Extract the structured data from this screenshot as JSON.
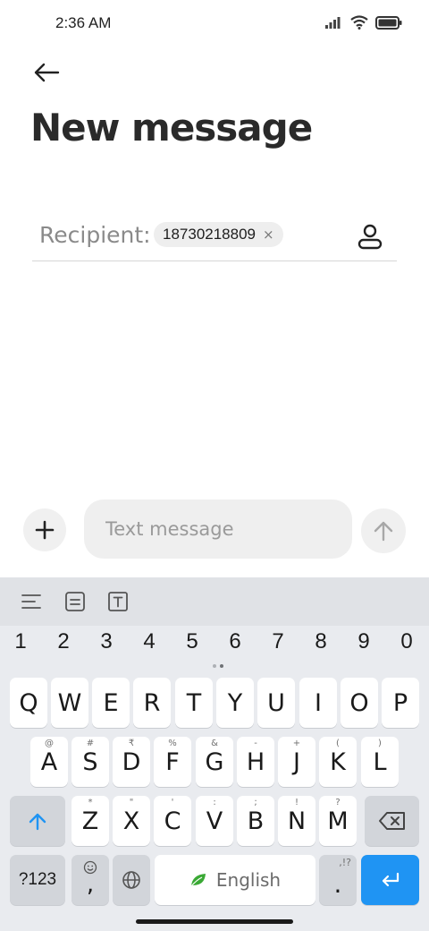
{
  "status": {
    "time": "2:36 AM",
    "icons": [
      "signal-icon",
      "wifi-icon",
      "battery-icon"
    ]
  },
  "header": {
    "back_icon": "arrow-left-icon",
    "title": "New message"
  },
  "recipient": {
    "label": "Recipient:",
    "chip_number": "18730218809",
    "chip_close": "×",
    "contact_icon": "person-icon"
  },
  "compose": {
    "attach_icon": "plus-icon",
    "placeholder": "Text message",
    "send_icon": "arrow-up-icon"
  },
  "keyboard": {
    "toolbar": [
      "menu-icon",
      "clipboard-icon",
      "text-format-icon"
    ],
    "numbers": [
      "1",
      "2",
      "3",
      "4",
      "5",
      "6",
      "7",
      "8",
      "9",
      "0"
    ],
    "row1": [
      "Q",
      "W",
      "E",
      "R",
      "T",
      "Y",
      "U",
      "I",
      "O",
      "P"
    ],
    "row2": [
      "A",
      "S",
      "D",
      "F",
      "G",
      "H",
      "J",
      "K",
      "L"
    ],
    "row2_hints": [
      "@",
      "#",
      "₹",
      "%",
      "&",
      "-",
      "+",
      "(",
      ")"
    ],
    "row3": [
      "Z",
      "X",
      "C",
      "V",
      "B",
      "N",
      "M"
    ],
    "row3_hints": [
      "*",
      "\"",
      "'",
      ":",
      ";",
      "!",
      "?"
    ],
    "symbols_label": "?123",
    "comma_label": ",",
    "period_label": ".",
    "period_hint": ",!?",
    "space_label": "English",
    "accent": "#1f94f3"
  }
}
